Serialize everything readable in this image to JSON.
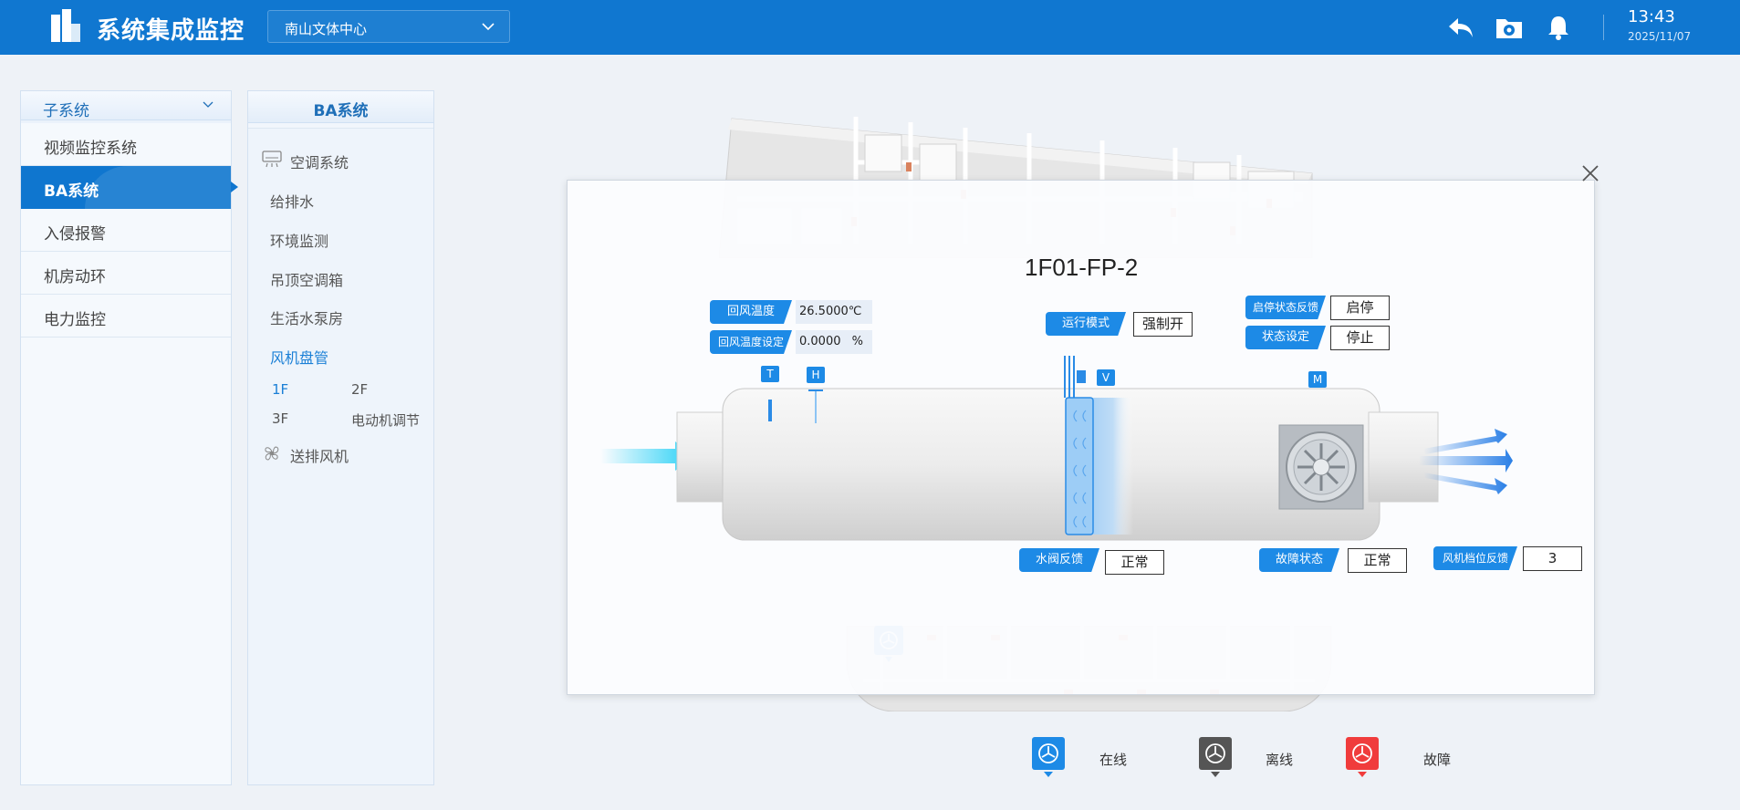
{
  "header": {
    "app_title": "系统集成监控",
    "site_select": "南山文体中心",
    "icons": [
      "back-arrow-icon",
      "settings-folder-icon",
      "bell-icon"
    ],
    "time": "13:43",
    "date": "2025/11/07",
    "accent_color": "#1077d0"
  },
  "subsystem_panel": {
    "header": "子系统",
    "items": [
      {
        "label": "视频监控系统",
        "active": false
      },
      {
        "label": "BA系统",
        "active": true
      },
      {
        "label": "入侵报警",
        "active": false
      },
      {
        "label": "机房动环",
        "active": false
      },
      {
        "label": "电力监控",
        "active": false
      }
    ]
  },
  "ba_panel": {
    "header": "BA系统",
    "aircon_label": "空调系统",
    "items": [
      "给排水",
      "环境监测",
      "吊顶空调箱",
      "生活水泵房"
    ],
    "fan_coil_label": "风机盘管",
    "floors": [
      "1F",
      "2F",
      "3F",
      "电动机调节"
    ],
    "exhaust_label": "送排风机"
  },
  "device": {
    "title": "1F01-FP-2",
    "return_temp_label": "回风温度",
    "return_temp_value": "26.5000℃",
    "return_temp_set_label": "回风温度设定",
    "return_temp_set_value": "0.0000",
    "return_temp_set_unit": "%",
    "run_mode_label": "运行模式",
    "run_mode_value": "强制开",
    "start_stop_feedback_label": "启停状态反馈",
    "start_stop_feedback_value": "启停",
    "state_set_label": "状态设定",
    "state_set_value": "停止",
    "valve_feedback_label": "水阀反馈",
    "valve_feedback_value": "正常",
    "fault_label": "故障状态",
    "fault_value": "正常",
    "fan_speed_label": "风机档位反馈",
    "fan_speed_value": "3",
    "sensors": {
      "t": "T",
      "h": "H",
      "v": "V",
      "m": "M"
    }
  },
  "legend": {
    "online": "在线",
    "offline": "离线",
    "fault": "故障",
    "colors": {
      "online": "#1d8ae6",
      "offline": "#555555",
      "fault": "#f03c3c"
    }
  }
}
